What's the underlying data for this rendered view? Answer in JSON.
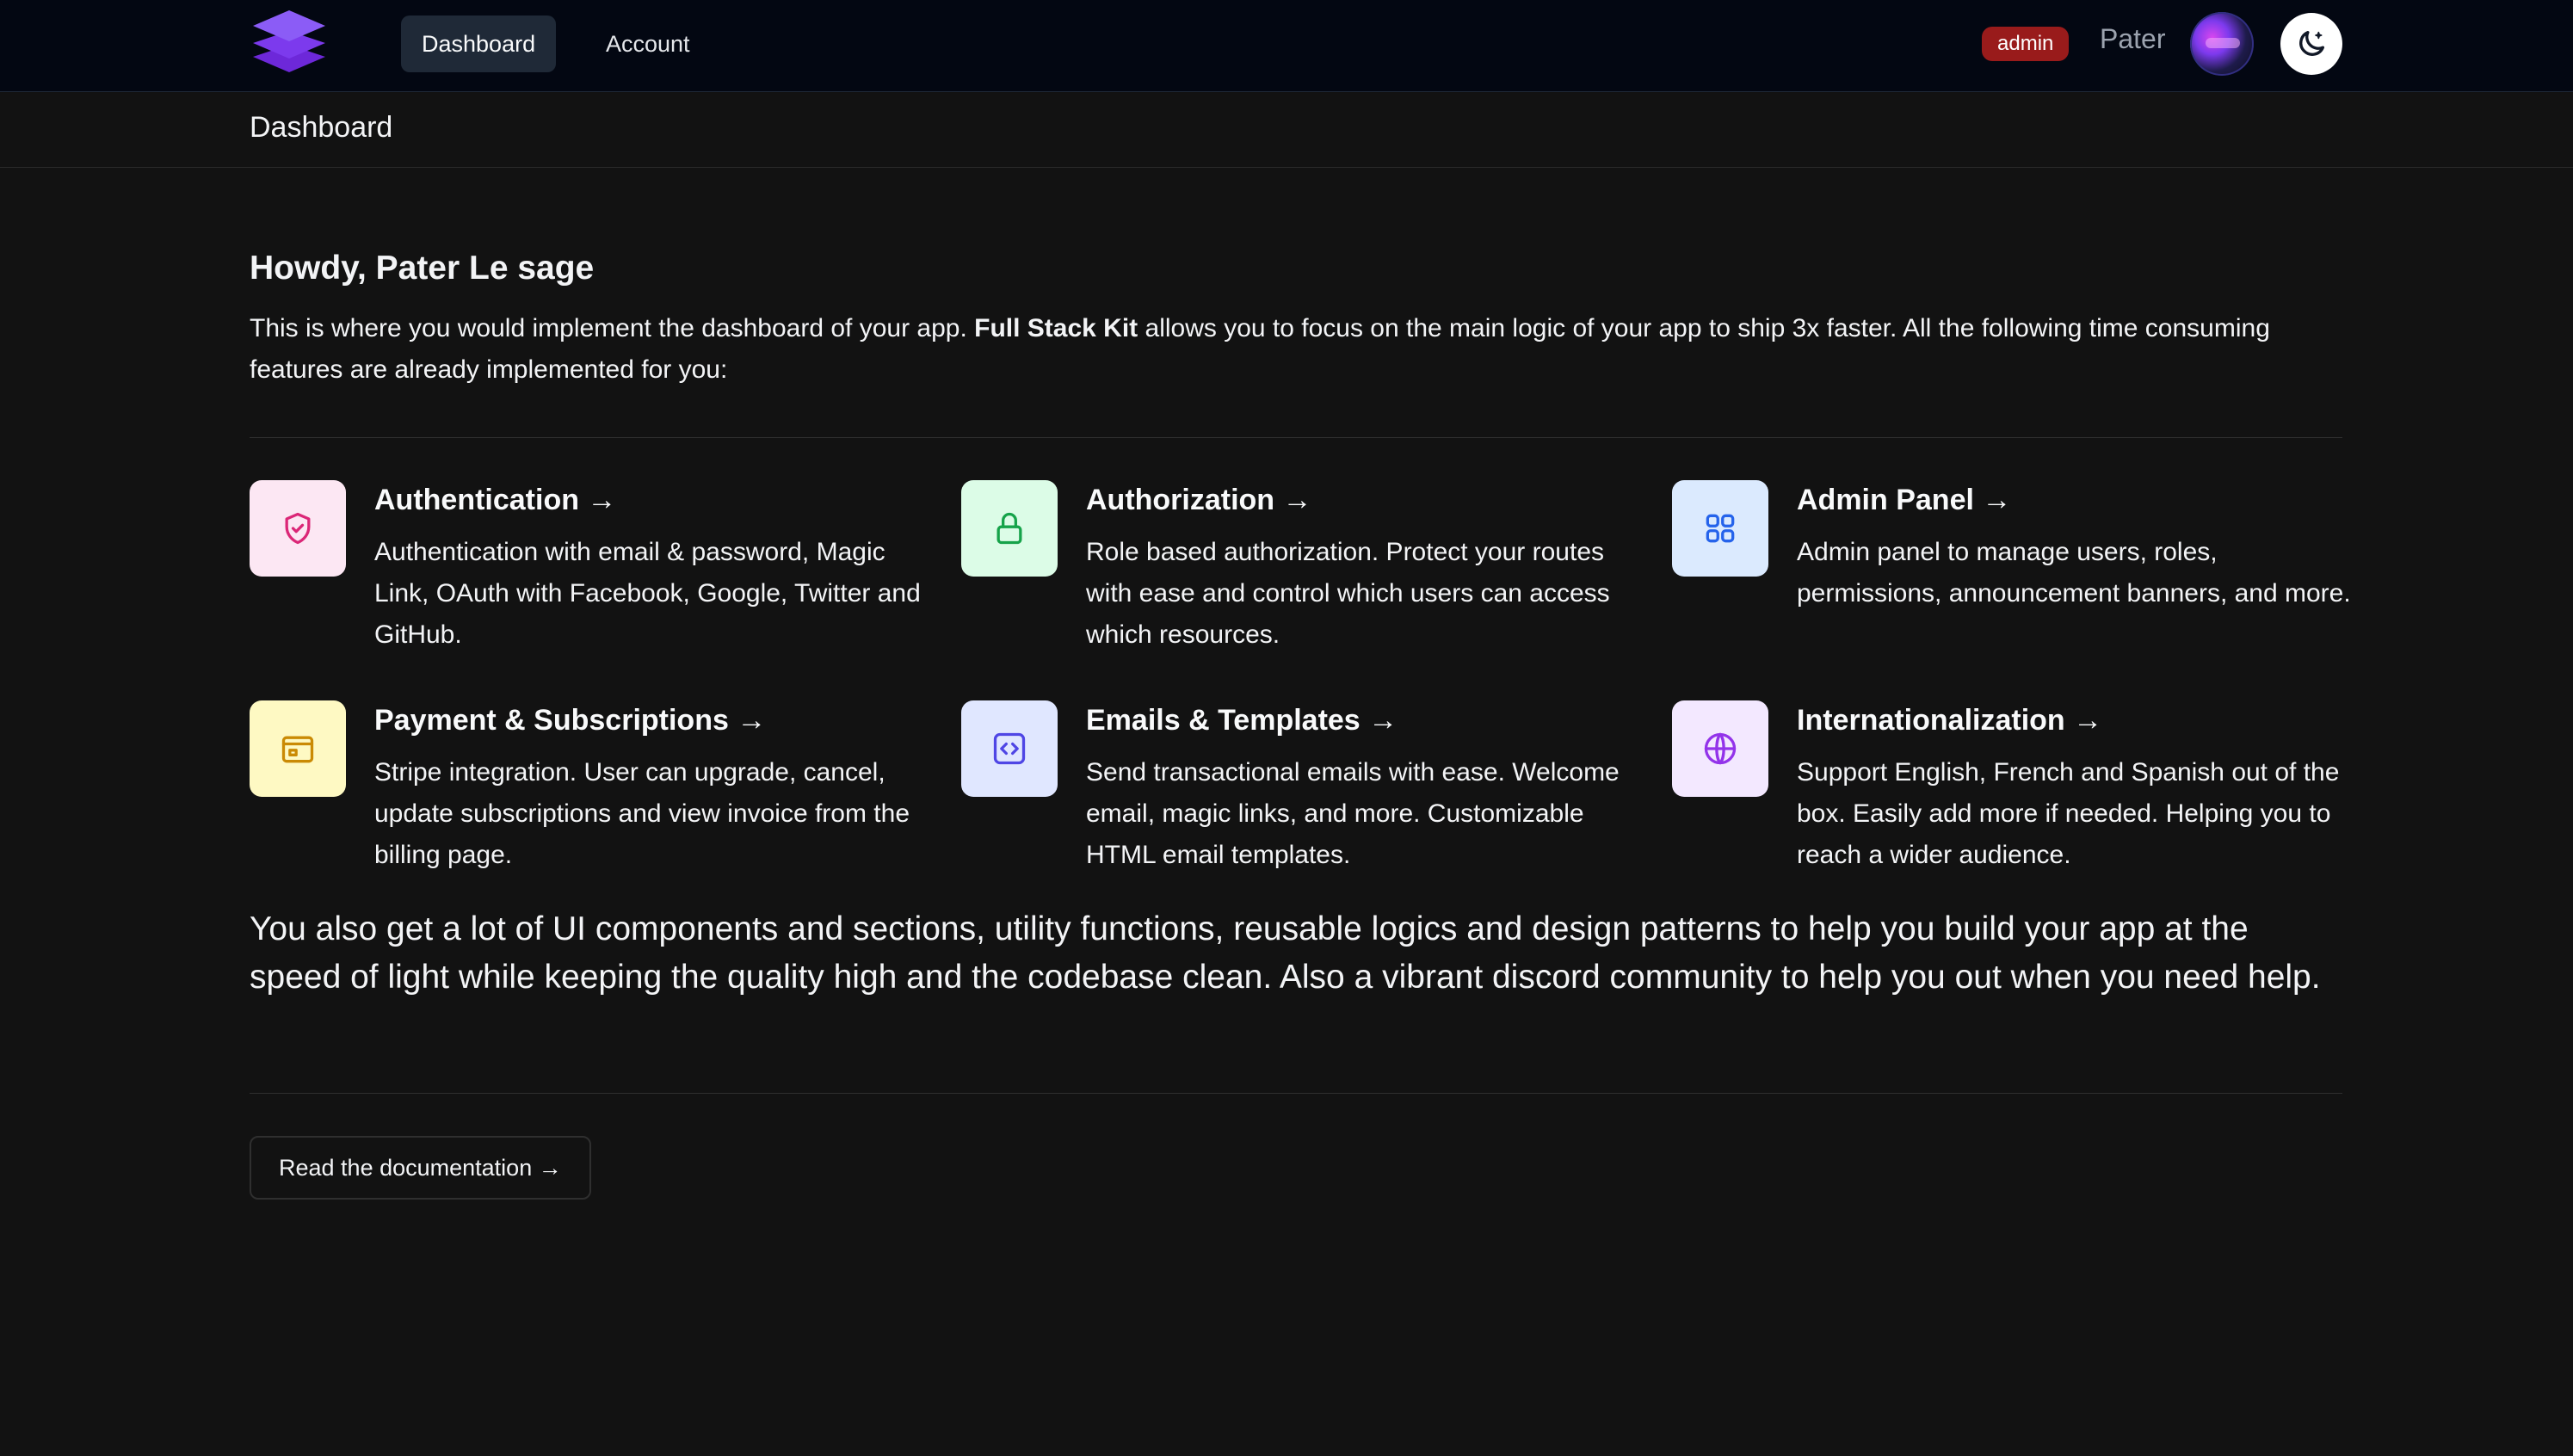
{
  "nav": {
    "tabs": [
      {
        "label": "Dashboard",
        "active": true
      },
      {
        "label": "Account",
        "active": false
      }
    ],
    "role_badge": "admin",
    "username": "Pater",
    "logo_icon": "stacked-layers-logo",
    "theme_icon": "moon-icon"
  },
  "page": {
    "title": "Dashboard"
  },
  "main": {
    "greeting": "Howdy, Pater Le sage",
    "intro": {
      "before": "This is where you would implement the dashboard of your app. ",
      "bold": "Full Stack Kit",
      "after": " allows you to focus on the main logic of your app to ship 3x faster. All the following time consuming features are already implemented for you:"
    },
    "features": [
      {
        "title": "Authentication →",
        "desc": "Authentication with email & password, Magic Link, OAuth with Facebook, Google, Twitter and GitHub.",
        "icon": "shield-check-icon",
        "bg": "#fce7f3",
        "fg": "#db2777"
      },
      {
        "title": "Authorization →",
        "desc": "Role based authorization. Protect your routes with ease and control which users can access which resources.",
        "icon": "lock-icon",
        "bg": "#dcfce7",
        "fg": "#16a34a"
      },
      {
        "title": "Admin Panel →",
        "desc": "Admin panel to manage users, roles, permissions, announcement banners, and more.",
        "icon": "grid-icon",
        "bg": "#dbeafe",
        "fg": "#2563eb"
      },
      {
        "title": "Payment & Subscriptions →",
        "desc": "Stripe integration. User can upgrade, cancel, update subscriptions and view invoice from the billing page.",
        "icon": "wallet-icon",
        "bg": "#fef9c3",
        "fg": "#ca8a04"
      },
      {
        "title": "Emails & Templates →",
        "desc": "Send transactional emails with ease. Welcome email, magic links, and more. Customizable HTML email templates.",
        "icon": "code-icon",
        "bg": "#e0e7ff",
        "fg": "#4f46e5"
      },
      {
        "title": "Internationalization →",
        "desc": "Support English, French and Spanish out of the box. Easily add more if needed. Helping you to reach a wider audience.",
        "icon": "globe-icon",
        "bg": "#f3e8ff",
        "fg": "#9333ea"
      }
    ],
    "outro": "You also get a lot of UI components and sections, utility functions, reusable logics and design patterns to help you build your app at the speed of light while keeping the quality high and the codebase clean. Also a vibrant discord community to help you out when you need help.",
    "doc_button": "Read the documentation →"
  }
}
